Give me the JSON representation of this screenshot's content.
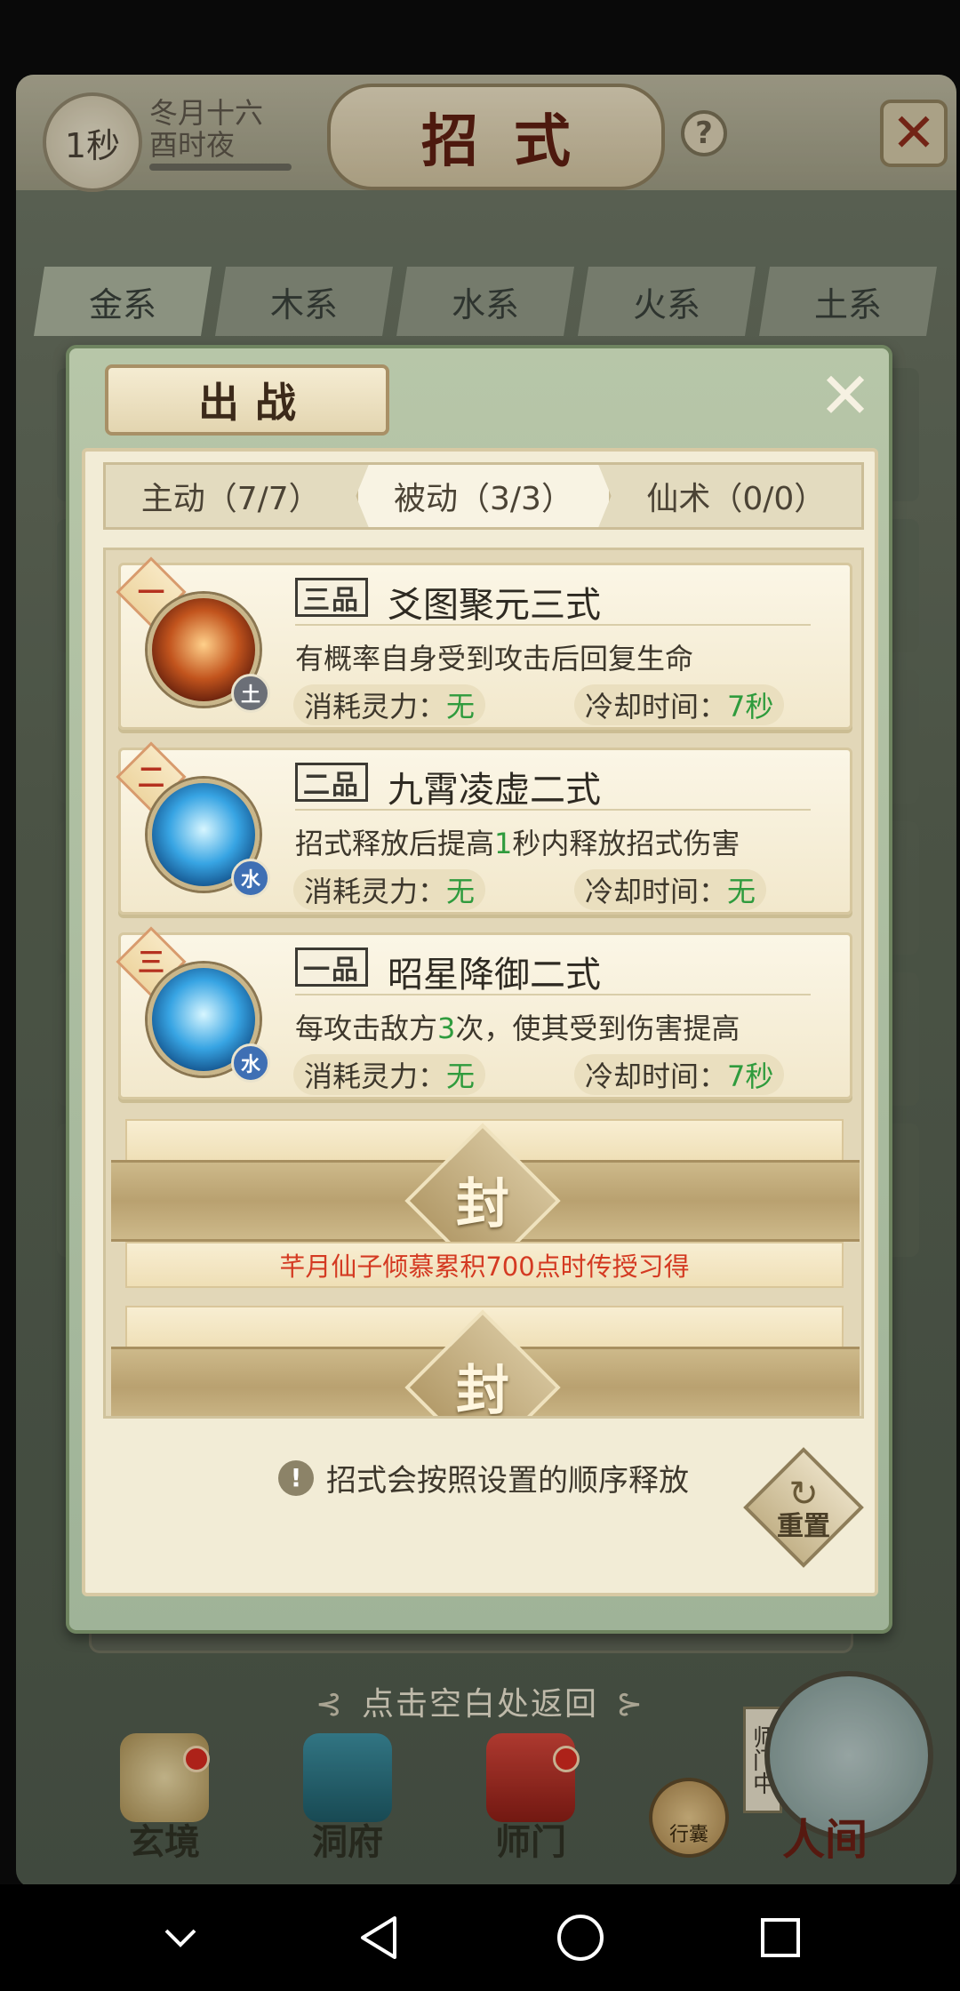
{
  "header": {
    "timer": "1秒",
    "date_line1": "冬月十六",
    "date_line2": "酉时夜",
    "title": "招式"
  },
  "element_tabs": [
    "金系",
    "木系",
    "水系",
    "火系",
    "土系"
  ],
  "modal": {
    "title": "出战",
    "tabs": [
      {
        "label": "主动（7/7）",
        "active": false
      },
      {
        "label": "被动（3/3）",
        "active": true
      },
      {
        "label": "仙术（0/0）",
        "active": false
      }
    ],
    "skills": [
      {
        "order": "一",
        "grade": "三品",
        "name": "爻图聚元三式",
        "element": "土",
        "desc_parts": [
          "有概率自身受到攻击后回复生命"
        ],
        "cost_label": "消耗灵力：",
        "cost_value": "无",
        "cooldown_label": "冷却时间：",
        "cooldown_value": "7秒"
      },
      {
        "order": "二",
        "grade": "二品",
        "name": "九霄凌虚二式",
        "element": "水",
        "desc_parts": [
          "招式释放后提高",
          "1",
          "秒内释放招式伤害"
        ],
        "cost_label": "消耗灵力：",
        "cost_value": "无",
        "cooldown_label": "冷却时间：",
        "cooldown_value": "无"
      },
      {
        "order": "三",
        "grade": "一品",
        "name": "昭星降御二式",
        "element": "水",
        "desc_parts": [
          "每攻击敌方",
          "3",
          "次，使其受到伤害提高"
        ],
        "cost_label": "消耗灵力：",
        "cost_value": "无",
        "cooldown_label": "冷却时间：",
        "cooldown_value": "7秒"
      }
    ],
    "locked_slots": [
      {
        "seal": "封",
        "condition": "芊月仙子倾慕累积700点时传授习得"
      },
      {
        "seal": "封",
        "condition": ""
      }
    ],
    "note": "招式会按照设置的顺序释放",
    "reset_label": "重置"
  },
  "return_hint": "点击空白处返回",
  "bottom_nav": [
    {
      "label": "玄境",
      "badge": true
    },
    {
      "label": "洞府",
      "badge": false
    },
    {
      "label": "师门",
      "badge": true
    },
    {
      "label": "行囊",
      "badge": false
    },
    {
      "label": "人间",
      "badge": false
    }
  ],
  "sect_banner": "师门中",
  "colors": {
    "highlight_green": "#2f9b3d",
    "lock_condition_red": "#d43a22",
    "modal_frame": "#9fb398"
  }
}
